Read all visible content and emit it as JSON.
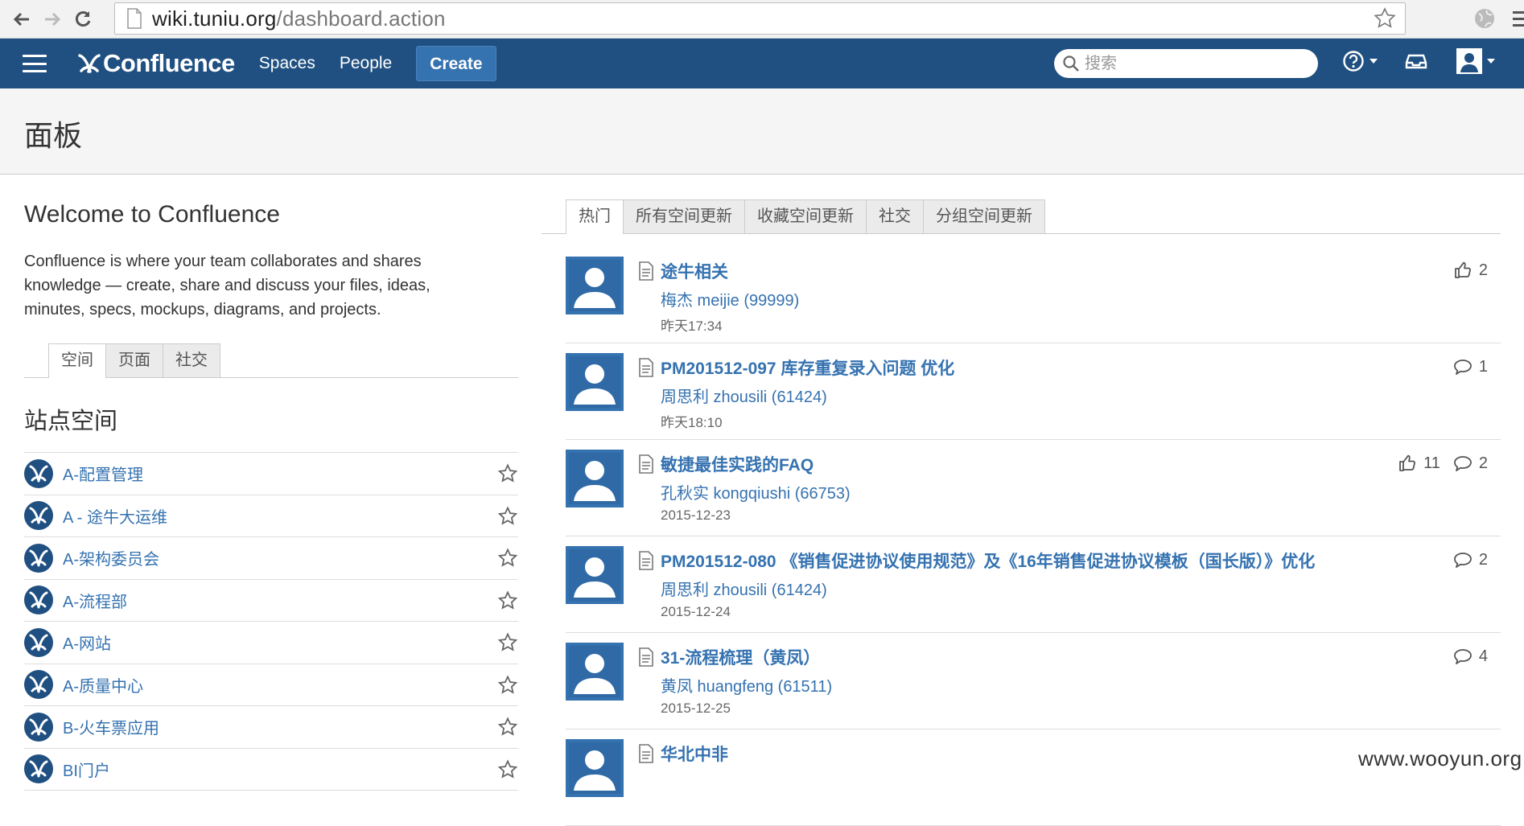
{
  "browser": {
    "url_host": "wiki.tuniu.org",
    "url_path": "/dashboard.action"
  },
  "header": {
    "logo_text": "Confluence",
    "nav": [
      "Spaces",
      "People"
    ],
    "create_label": "Create",
    "search_placeholder": "搜索"
  },
  "page": {
    "title": "面板"
  },
  "welcome": {
    "title": "Welcome to Confluence",
    "text": "Confluence is where your team collaborates and shares knowledge — create, share and discuss your files, ideas, minutes, specs, mockups, diagrams, and projects."
  },
  "left_tabs": [
    "空间",
    "页面",
    "社交"
  ],
  "site_spaces": {
    "title": "站点空间",
    "items": [
      "A-配置管理",
      "A - 途牛大运维",
      "A-架构委员会",
      "A-流程部",
      "A-网站",
      "A-质量中心",
      "B-火车票应用",
      "BI门户"
    ]
  },
  "right_tabs": [
    "热门",
    "所有空间更新",
    "收藏空间更新",
    "社交",
    "分组空间更新"
  ],
  "feed": [
    {
      "title": "途牛相关",
      "author": "梅杰 meijie (99999)",
      "date": "昨天17:34",
      "likes": "2",
      "comments": null
    },
    {
      "title": "PM201512-097 库存重复录入问题 优化",
      "author": "周思利 zhousili (61424)",
      "date": "昨天18:10",
      "likes": null,
      "comments": "1"
    },
    {
      "title": "敏捷最佳实践的FAQ",
      "author": "孔秋实 kongqiushi (66753)",
      "date": "2015-12-23",
      "likes": "11",
      "comments": "2"
    },
    {
      "title": "PM201512-080 《销售促进协议使用规范》及《16年销售促进协议模板（国长版）》优化",
      "author": "周思利 zhousili (61424)",
      "date": "2015-12-24",
      "likes": null,
      "comments": "2"
    },
    {
      "title": "31-流程梳理（黄凤）",
      "author": "黄凤 huangfeng (61511)",
      "date": "2015-12-25",
      "likes": null,
      "comments": "4"
    },
    {
      "title": "华北中非",
      "author": "",
      "date": "",
      "likes": null,
      "comments": null
    }
  ],
  "watermark": "www.wooyun.org",
  "colors": {
    "header": "#205081",
    "link": "#3572b0",
    "create": "#3572b0"
  }
}
